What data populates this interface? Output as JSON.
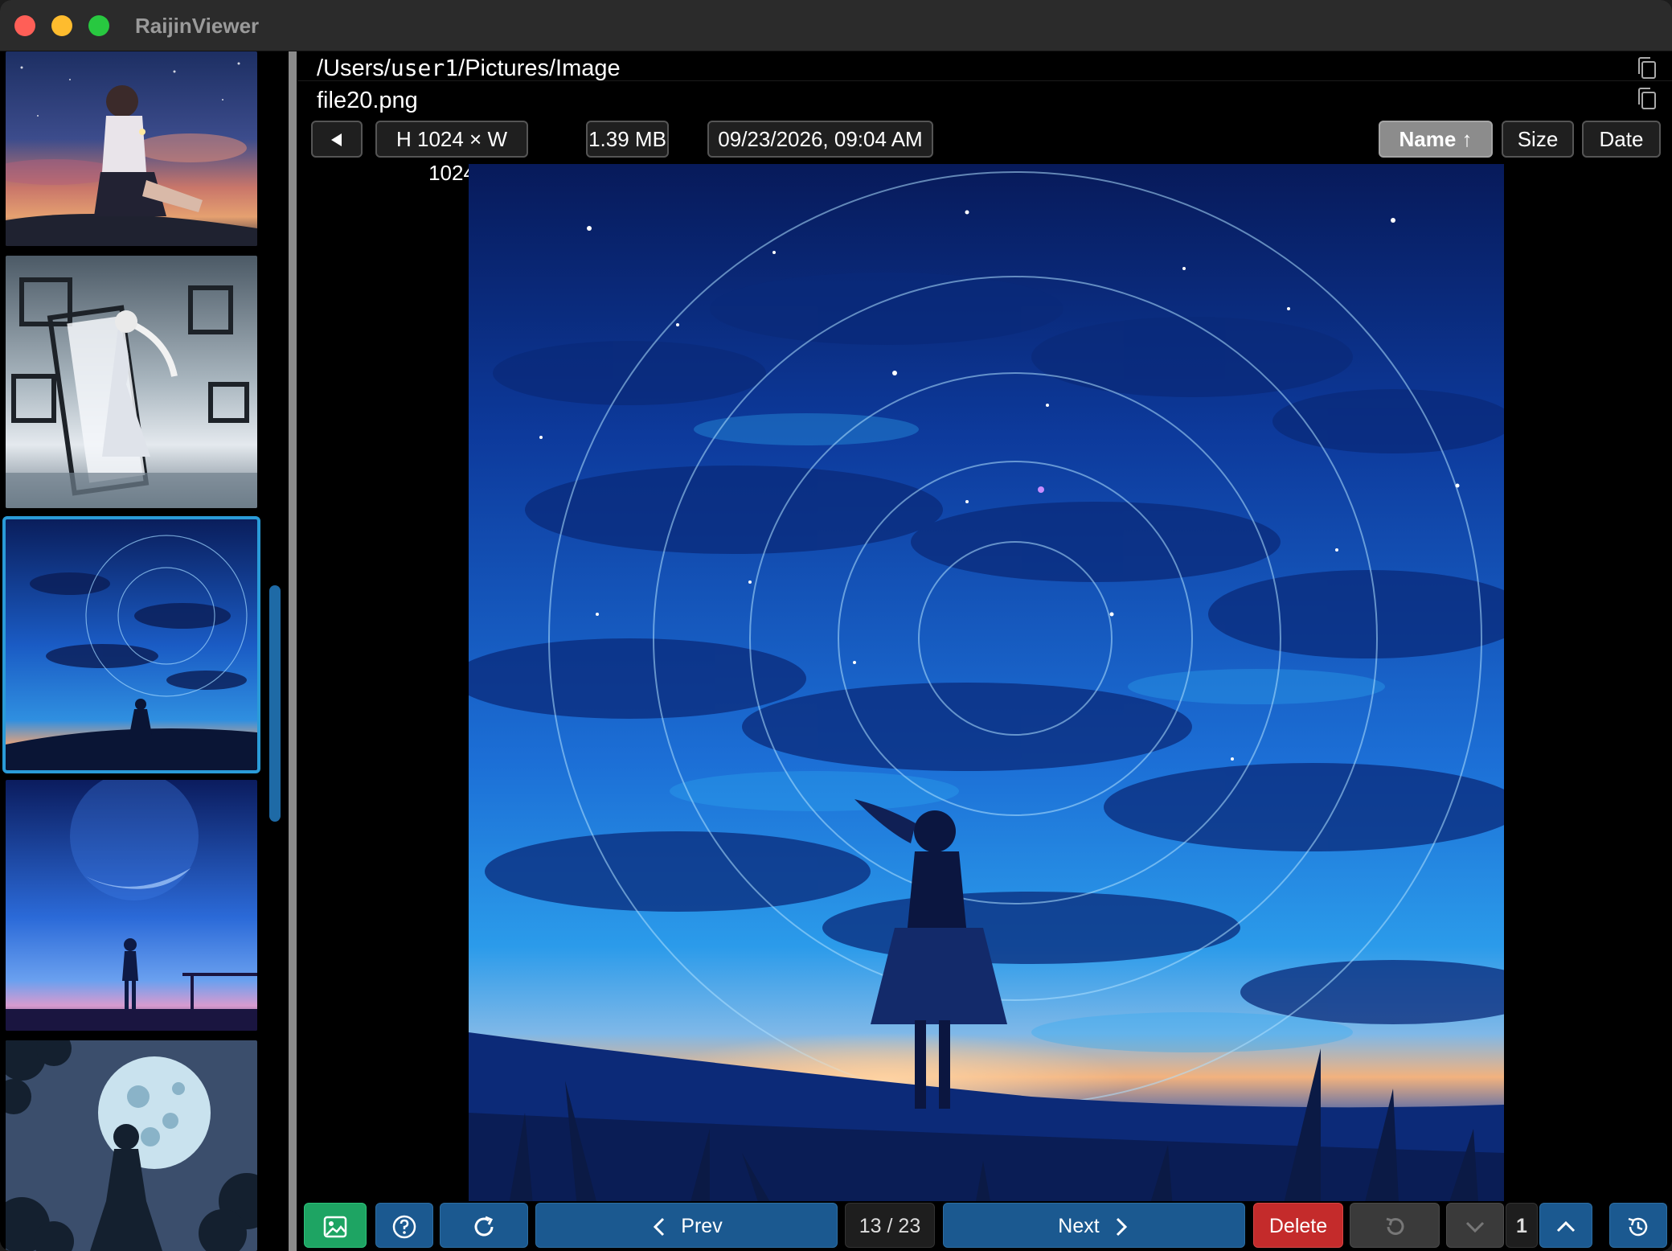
{
  "window": {
    "title": "RaijinViewer"
  },
  "header": {
    "path_prefix": "/Users/",
    "path_user": "user1",
    "path_suffix": "/Pictures/Image",
    "filename": "file20.png"
  },
  "info_bar": {
    "back_icon": "triangle-left-icon",
    "dimensions": "H 1024 × W 1024",
    "file_size": "1.39 MB",
    "date": "09/23/2026, 09:04 AM"
  },
  "sort": {
    "name_label": "Name ↑",
    "size_label": "Size",
    "date_label": "Date",
    "active": "name"
  },
  "thumbnails": [
    {
      "icon": "thumbnail-girl-sitting-sunset"
    },
    {
      "icon": "thumbnail-girl-with-frames"
    },
    {
      "icon": "thumbnail-girl-star-trails",
      "selected": true
    },
    {
      "icon": "thumbnail-girl-moon-night"
    },
    {
      "icon": "thumbnail-girl-silhouette-moon"
    }
  ],
  "toolbar": {
    "image_icon": "image-icon",
    "help_icon": "question-circle-icon",
    "refresh_icon": "refresh-icon",
    "prev_label": "Prev",
    "counter": "13 / 23",
    "next_label": "Next",
    "delete_label": "Delete",
    "undo_icon": "undo-icon",
    "down_icon": "chevron-down-icon",
    "page_value": "1",
    "up_icon": "chevron-up-icon",
    "history_icon": "history-icon"
  },
  "colors": {
    "accent_blue": "#1b5990",
    "selection": "#2a9bd8",
    "green": "#1ea463",
    "red": "#c42b2b"
  }
}
